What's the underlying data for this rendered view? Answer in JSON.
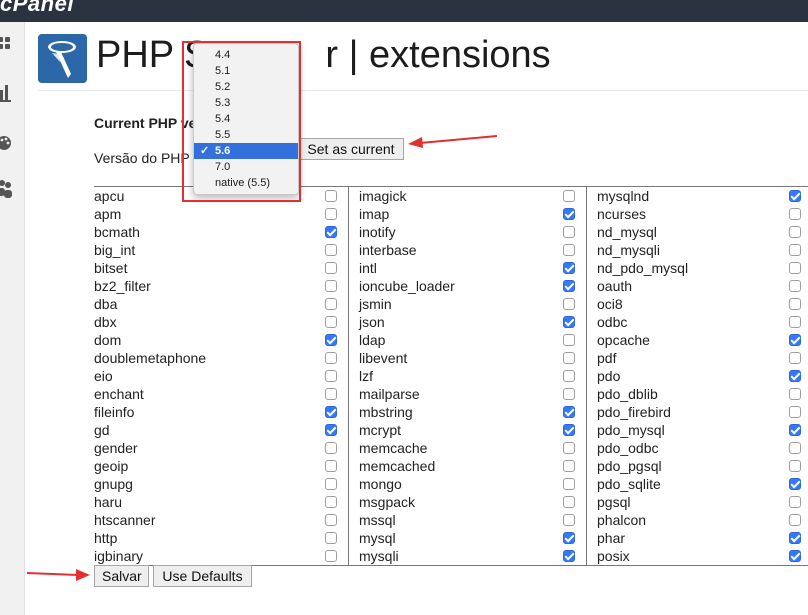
{
  "app": {
    "logo_text": "cPanel",
    "title_visible_start": "PHP S",
    "title_visible_end": "r | extensions"
  },
  "sidebar": {
    "icons": [
      "grid-icon",
      "bar-chart-icon",
      "palette-icon",
      "users-icon"
    ]
  },
  "form": {
    "current_label": "Current PHP ve",
    "version_label": "Versão do PHP",
    "set_current_label": "Set as current",
    "save_label": "Salvar",
    "defaults_label": "Use Defaults"
  },
  "version_dropdown": {
    "options": [
      "4.4",
      "5.1",
      "5.2",
      "5.3",
      "5.4",
      "5.5",
      "5.6",
      "7.0",
      "native (5.5)"
    ],
    "selected": "5.6"
  },
  "extensions": {
    "col1": [
      {
        "name": "apcu",
        "checked": false
      },
      {
        "name": "apm",
        "checked": false
      },
      {
        "name": "bcmath",
        "checked": true
      },
      {
        "name": "big_int",
        "checked": false
      },
      {
        "name": "bitset",
        "checked": false
      },
      {
        "name": "bz2_filter",
        "checked": false
      },
      {
        "name": "dba",
        "checked": false
      },
      {
        "name": "dbx",
        "checked": false
      },
      {
        "name": "dom",
        "checked": true
      },
      {
        "name": "doublemetaphone",
        "checked": false
      },
      {
        "name": "eio",
        "checked": false
      },
      {
        "name": "enchant",
        "checked": false
      },
      {
        "name": "fileinfo",
        "checked": true
      },
      {
        "name": "gd",
        "checked": true
      },
      {
        "name": "gender",
        "checked": false
      },
      {
        "name": "geoip",
        "checked": false
      },
      {
        "name": "gnupg",
        "checked": false
      },
      {
        "name": "haru",
        "checked": false
      },
      {
        "name": "htscanner",
        "checked": false
      },
      {
        "name": "http",
        "checked": false
      },
      {
        "name": "igbinary",
        "checked": false
      }
    ],
    "col2": [
      {
        "name": "imagick",
        "checked": false
      },
      {
        "name": "imap",
        "checked": true
      },
      {
        "name": "inotify",
        "checked": false
      },
      {
        "name": "interbase",
        "checked": false
      },
      {
        "name": "intl",
        "checked": true
      },
      {
        "name": "ioncube_loader",
        "checked": true
      },
      {
        "name": "jsmin",
        "checked": false
      },
      {
        "name": "json",
        "checked": true
      },
      {
        "name": "ldap",
        "checked": false
      },
      {
        "name": "libevent",
        "checked": false
      },
      {
        "name": "lzf",
        "checked": false
      },
      {
        "name": "mailparse",
        "checked": false
      },
      {
        "name": "mbstring",
        "checked": true
      },
      {
        "name": "mcrypt",
        "checked": true
      },
      {
        "name": "memcache",
        "checked": false
      },
      {
        "name": "memcached",
        "checked": false
      },
      {
        "name": "mongo",
        "checked": false
      },
      {
        "name": "msgpack",
        "checked": false
      },
      {
        "name": "mssql",
        "checked": false
      },
      {
        "name": "mysql",
        "checked": true
      },
      {
        "name": "mysqli",
        "checked": true
      }
    ],
    "col3": [
      {
        "name": "mysqlnd",
        "checked": true
      },
      {
        "name": "ncurses",
        "checked": false
      },
      {
        "name": "nd_mysql",
        "checked": false
      },
      {
        "name": "nd_mysqli",
        "checked": false
      },
      {
        "name": "nd_pdo_mysql",
        "checked": false
      },
      {
        "name": "oauth",
        "checked": false
      },
      {
        "name": "oci8",
        "checked": false
      },
      {
        "name": "odbc",
        "checked": false
      },
      {
        "name": "opcache",
        "checked": true
      },
      {
        "name": "pdf",
        "checked": false
      },
      {
        "name": "pdo",
        "checked": true
      },
      {
        "name": "pdo_dblib",
        "checked": false
      },
      {
        "name": "pdo_firebird",
        "checked": false
      },
      {
        "name": "pdo_mysql",
        "checked": true
      },
      {
        "name": "pdo_odbc",
        "checked": false
      },
      {
        "name": "pdo_pgsql",
        "checked": false
      },
      {
        "name": "pdo_sqlite",
        "checked": true
      },
      {
        "name": "pgsql",
        "checked": false
      },
      {
        "name": "phalcon",
        "checked": false
      },
      {
        "name": "phar",
        "checked": true
      },
      {
        "name": "posix",
        "checked": true
      }
    ]
  },
  "colors": {
    "topbar": "#2b3340",
    "checkbox_on": "#3579f6",
    "annotation_red": "#e03030",
    "dropdown_selected": "#3470db"
  }
}
